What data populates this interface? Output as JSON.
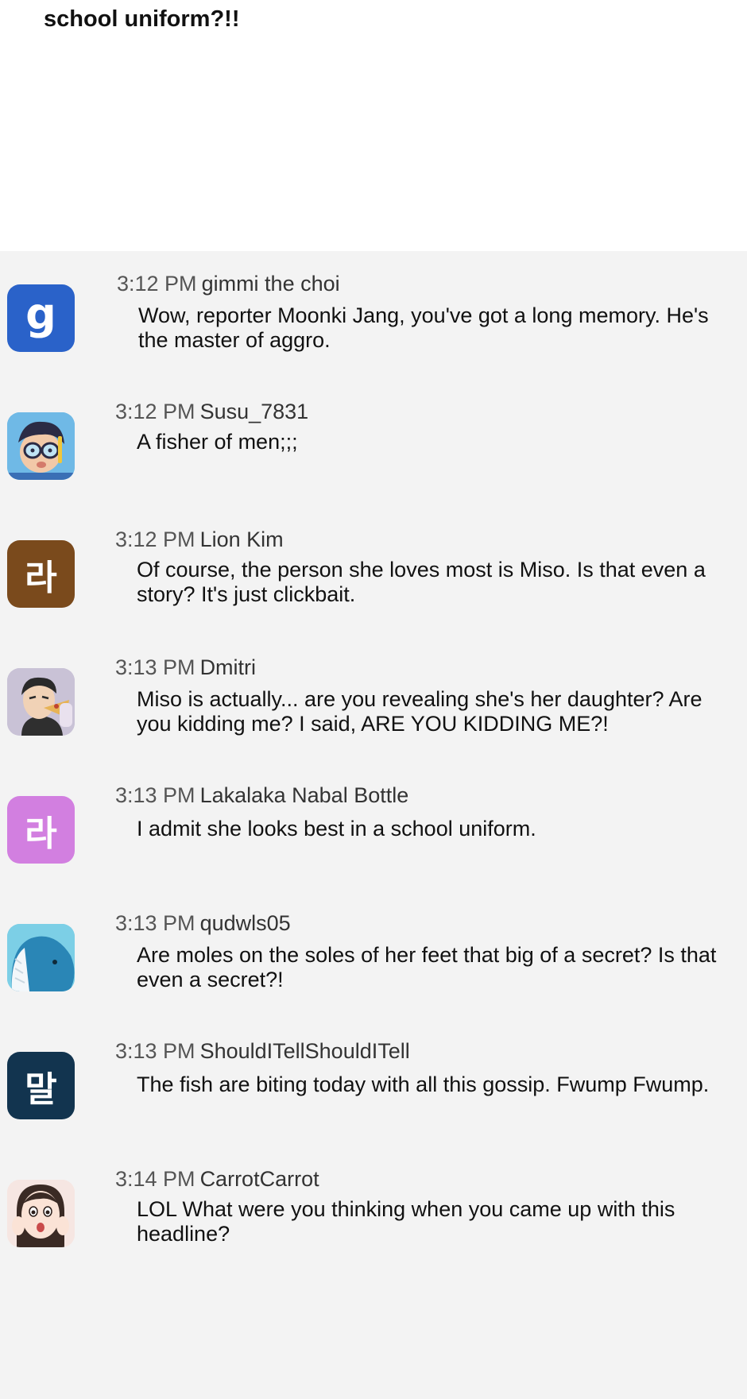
{
  "article": {
    "headline_visible_line": "school uniform?!!"
  },
  "comments": [
    {
      "time": "3:12 PM",
      "user": "gimmi the choi",
      "text": "Wow, reporter Moonki Jang, you've got a long memory. He's the master of aggro.",
      "avatar": {
        "type": "letter",
        "glyph": "g",
        "color": "#2a62c9"
      }
    },
    {
      "time": "3:12 PM",
      "user": "Susu_7831",
      "text": "A fisher of men;;;",
      "avatar": {
        "type": "illustration",
        "icon": "snorkel-boy-icon",
        "color": "#6fb9e6"
      }
    },
    {
      "time": "3:12 PM",
      "user": "Lion Kim",
      "text": "Of course, the person she loves most is Miso. Is that even a story? It's just clickbait.",
      "avatar": {
        "type": "letter",
        "glyph": "라",
        "color": "#7a4a1c"
      }
    },
    {
      "time": "3:13 PM",
      "user": "Dmitri",
      "text": "Miso is actually... are you revealing she's her daughter? Are you kidding me? I said, ARE YOU KIDDING ME?!",
      "avatar": {
        "type": "illustration",
        "icon": "man-eating-pizza-icon",
        "color": "#c9c2d6"
      }
    },
    {
      "time": "3:13 PM",
      "user": "Lakalaka Nabal Bottle",
      "text": "I admit she looks best in a school uniform.",
      "avatar": {
        "type": "letter",
        "glyph": "라",
        "color": "#d27fe0"
      }
    },
    {
      "time": "3:13 PM",
      "user": "qudwls05",
      "text": "Are moles on the soles of her feet that big of a secret? Is that even a secret?!",
      "avatar": {
        "type": "illustration",
        "icon": "whale-icon",
        "color": "#7ccfe6"
      }
    },
    {
      "time": "3:13 PM",
      "user": "ShouldITellShouldITell",
      "text": "The fish are biting today with all this gossip. Fwump Fwump.",
      "avatar": {
        "type": "letter",
        "glyph": "말",
        "color": "#12344f"
      }
    },
    {
      "time": "3:14 PM",
      "user": "CarrotCarrot",
      "text": "LOL What were you thinking when you came up with this headline?",
      "avatar": {
        "type": "illustration",
        "icon": "surprised-girl-icon",
        "color": "#f6e6e2"
      }
    }
  ]
}
